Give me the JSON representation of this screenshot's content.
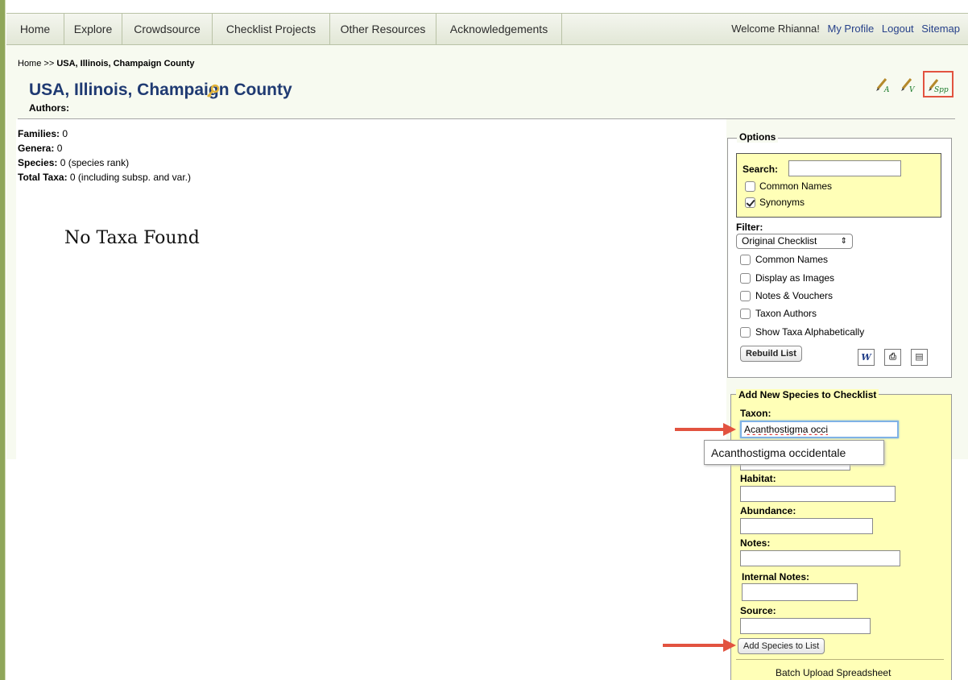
{
  "nav": {
    "items": [
      {
        "label": "Home"
      },
      {
        "label": "Explore"
      },
      {
        "label": "Crowdsource"
      },
      {
        "label": "Checklist Projects"
      },
      {
        "label": "Other Resources"
      },
      {
        "label": "Acknowledgements"
      }
    ],
    "welcome": "Welcome Rhianna!",
    "my_profile": "My Profile",
    "logout": "Logout",
    "sitemap": "Sitemap"
  },
  "breadcrumb": {
    "home": "Home",
    "separator": ">>",
    "current": "USA, Illinois, Champaign County"
  },
  "page": {
    "title": "USA, Illinois, Champaign County",
    "authors_label": "Authors:"
  },
  "stats": {
    "families_label": "Families:",
    "families_value": "0",
    "genera_label": "Genera:",
    "genera_value": "0",
    "species_label": "Species:",
    "species_value": "0 (species rank)",
    "total_label": "Total Taxa:",
    "total_value": "0 (including subsp. and var.)"
  },
  "empty_message": "No Taxa Found",
  "options": {
    "legend": "Options",
    "search_label": "Search:",
    "search_value": "",
    "search_common_names": "Common Names",
    "search_synonyms": "Synonyms",
    "filter_label": "Filter:",
    "filter_selected": "Original Checklist",
    "display_options": [
      {
        "label": "Common Names",
        "checked": false
      },
      {
        "label": "Display as Images",
        "checked": false
      },
      {
        "label": "Notes & Vouchers",
        "checked": false
      },
      {
        "label": "Taxon Authors",
        "checked": false
      },
      {
        "label": "Show Taxa Alphabetically",
        "checked": false
      }
    ],
    "rebuild_button": "Rebuild List"
  },
  "add_species": {
    "legend": "Add New Species to Checklist",
    "taxon_label": "Taxon:",
    "taxon_value": "Acanthostigma occi",
    "suggestion": "Acanthostigma occidentale",
    "habitat_label": "Habitat:",
    "abundance_label": "Abundance:",
    "notes_label": "Notes:",
    "internal_notes_label": "Internal Notes:",
    "source_label": "Source:",
    "add_button": "Add Species to List",
    "batch_link": "Batch Upload Spreadsheet"
  },
  "colors": {
    "nav_border": "#b9c2a6",
    "title_blue": "#1f3a72",
    "panel_yellow": "#ffffb7",
    "annotation_red": "#e25340",
    "link_blue": "#27418a"
  }
}
